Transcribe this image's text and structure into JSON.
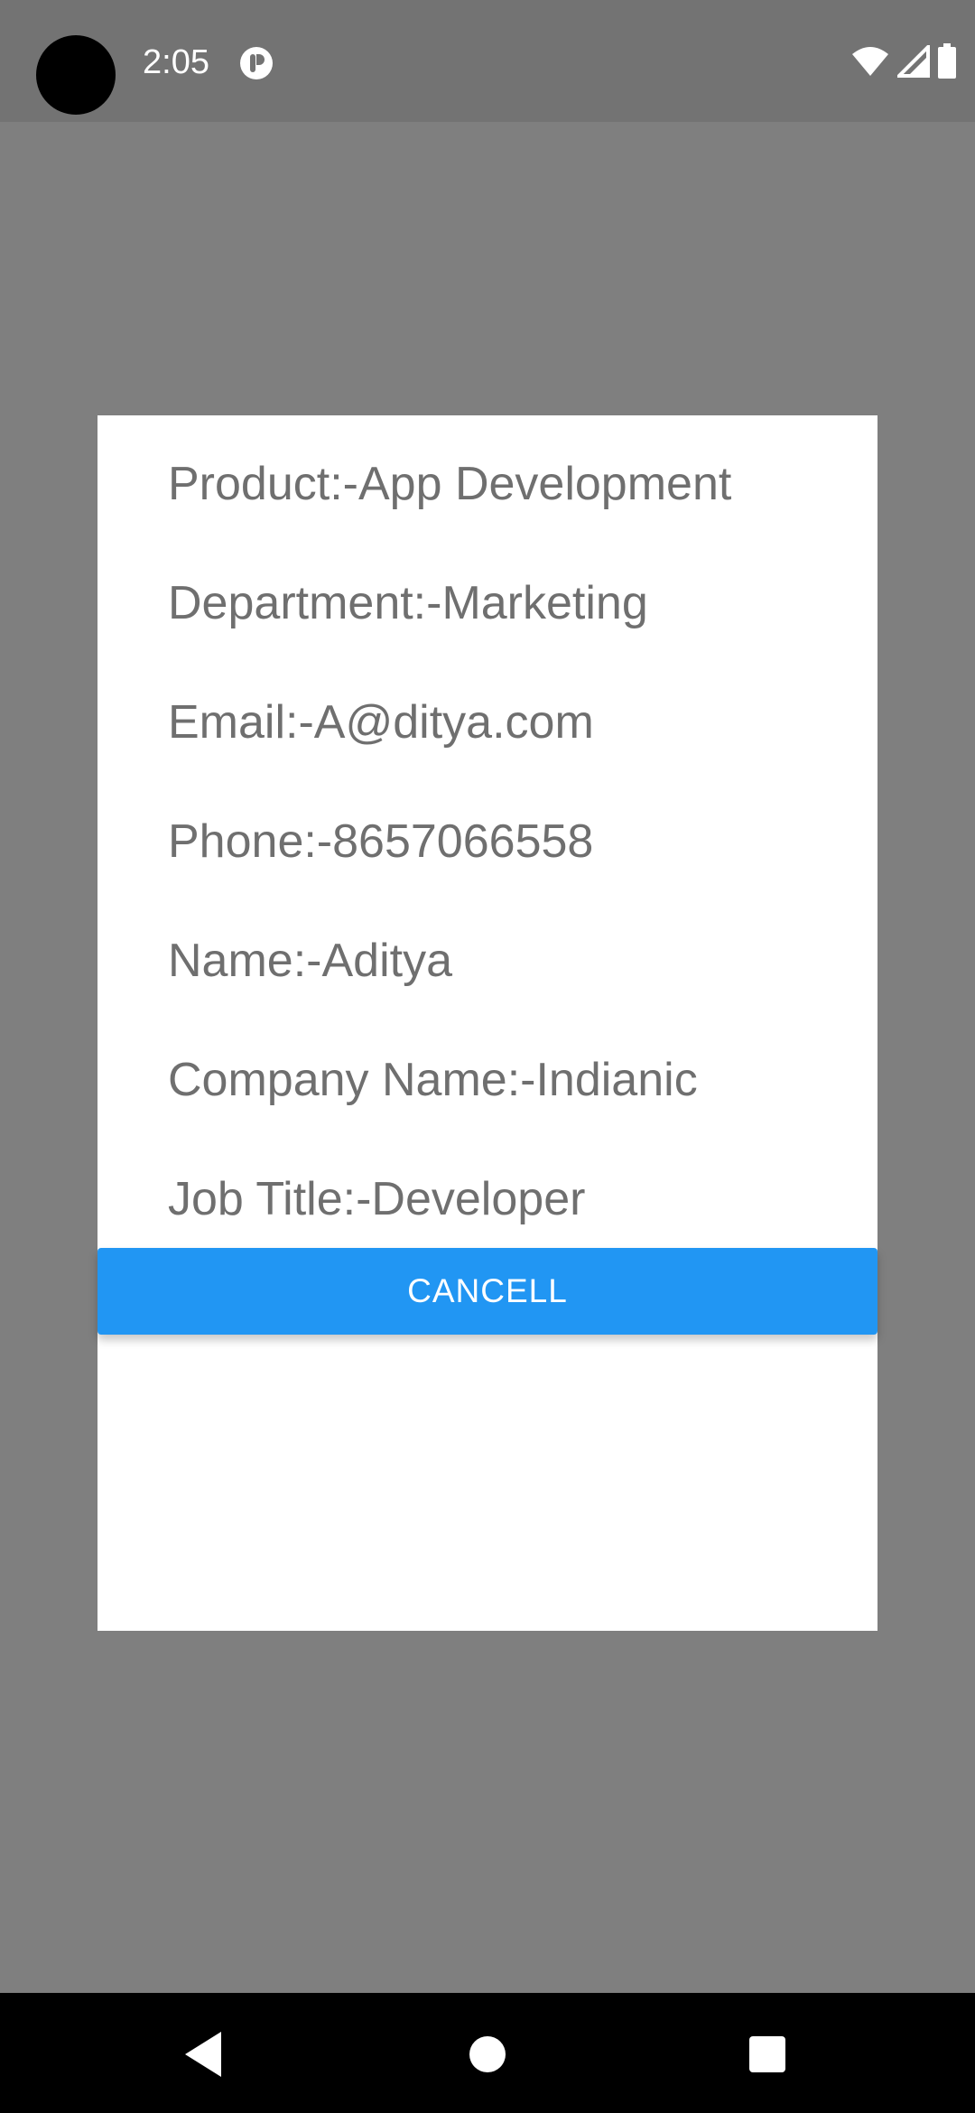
{
  "status_bar": {
    "time": "2:05",
    "icons": [
      "notification-icon",
      "wifi-icon",
      "signal-icon",
      "battery-icon"
    ]
  },
  "dialog": {
    "rows": [
      "Product:-App Development",
      "Department:-Marketing",
      "Email:-A@ditya.com",
      "Phone:-8657066558",
      "Name:-Aditya",
      "Company Name:-Indianic",
      "Job Title:-Developer"
    ],
    "cancel_label": "CANCELL"
  },
  "nav_bar": {
    "icons": [
      "back-icon",
      "home-icon",
      "recents-icon"
    ]
  },
  "colors": {
    "accent": "#2196f3",
    "scrim": "#7f7f7f",
    "status_bar": "#737373",
    "text": "#6f6f6f"
  }
}
